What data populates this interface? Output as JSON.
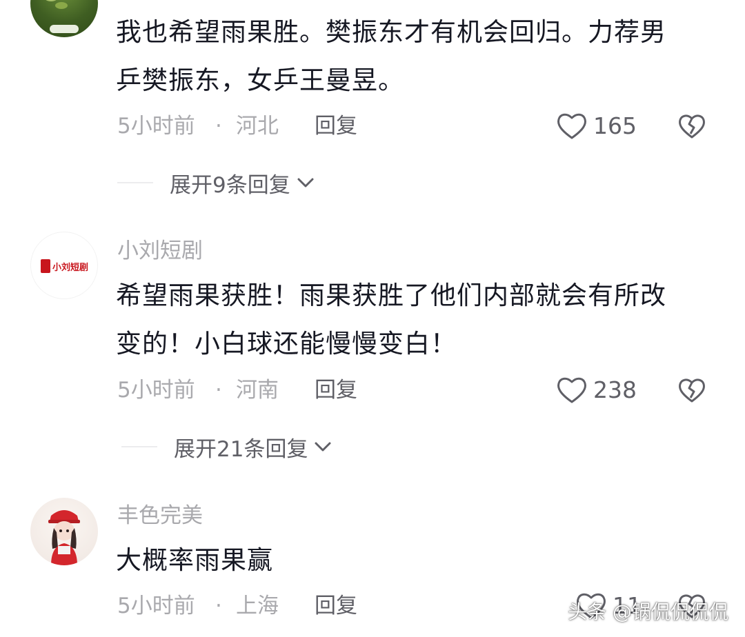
{
  "comments": [
    {
      "username": "",
      "content_lines": [
        "我也希望雨果胜。樊振东才有机会回归。力荐男",
        "乒樊振东，女乒王曼昱。"
      ],
      "time": "5小时前",
      "dot": "·",
      "location": "河北",
      "reply_label": "回复",
      "likes": "165",
      "expand_label": "展开9条回复"
    },
    {
      "username": "小刘短剧",
      "avatar_text": "小刘短剧",
      "content_lines": [
        "希望雨果获胜！雨果获胜了他们内部就会有所改",
        "变的！小白球还能慢慢变白！"
      ],
      "time": "5小时前",
      "dot": "·",
      "location": "河南",
      "reply_label": "回复",
      "likes": "238",
      "expand_label": "展开21条回复"
    },
    {
      "username": "丰色完美",
      "content_lines": [
        "大概率雨果赢"
      ],
      "time": "5小时前",
      "dot": "·",
      "location": "上海",
      "reply_label": "回复",
      "likes": "11"
    }
  ],
  "watermark": "头条 @锅侃侃侃侃",
  "icons": {
    "like": "heart-outline-icon",
    "dislike": "broken-heart-icon",
    "expand": "chevron-down-icon"
  },
  "colors": {
    "text_primary": "#161823",
    "text_secondary": "#a9a9ad",
    "text_action": "#5f5f66"
  }
}
